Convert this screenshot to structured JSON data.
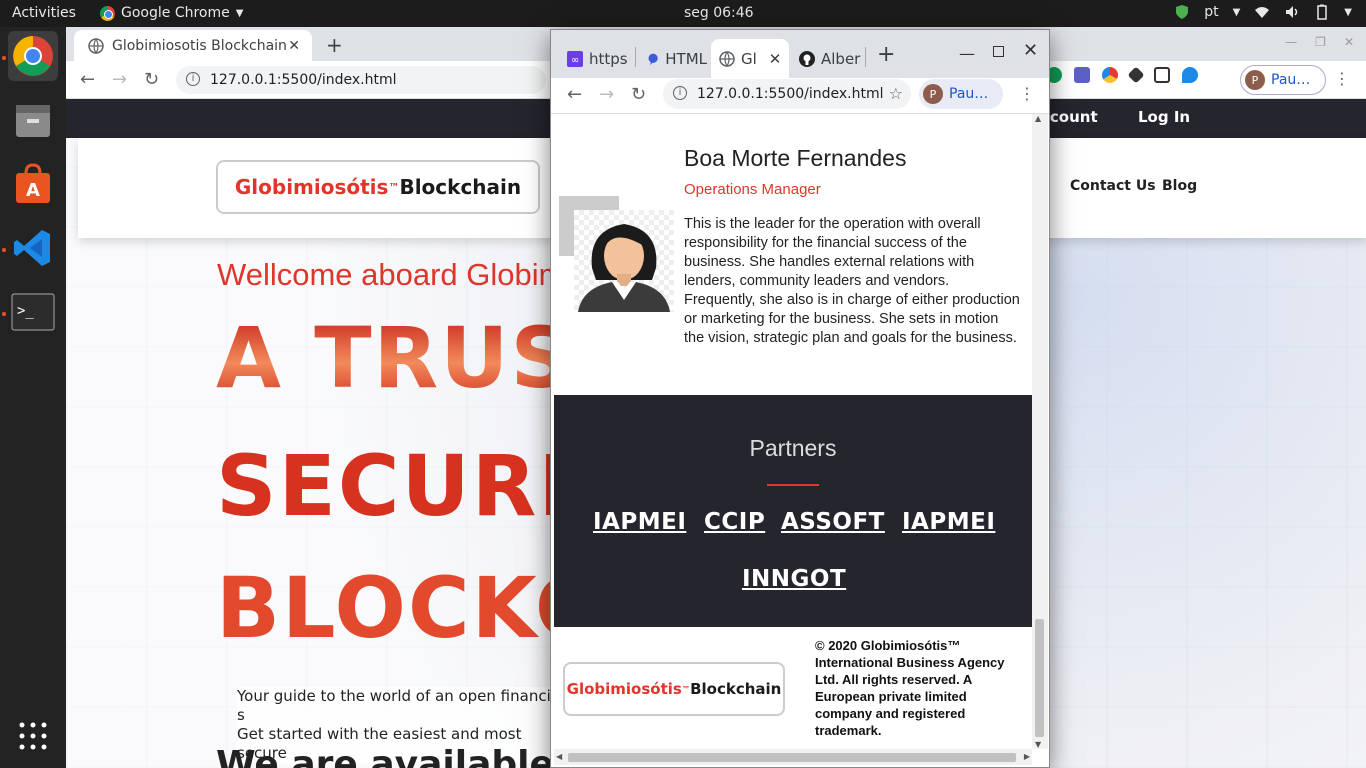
{
  "topbar": {
    "activities": "Activities",
    "app_name": "Google Chrome",
    "clock": "seg 06:46",
    "lang": "pt"
  },
  "dock": {
    "items": [
      "chrome-icon",
      "files-icon",
      "software-store-icon",
      "vscode-icon",
      "terminal-icon"
    ],
    "apps_grid": "show-applications-icon"
  },
  "bg_browser": {
    "tab_title": "Globimiosotis Blockchain",
    "url": "127.0.0.1:5500/index.html",
    "profile": "Pau…",
    "nav_account": "ccount",
    "nav_login": "Log In",
    "logo_red": "Globimiosótis",
    "logo_tm": "™",
    "logo_black": "Blockchain",
    "nav_contact": "Contact Us",
    "nav_blog": "Blog",
    "wellcome": "Wellcome aboard Globim",
    "hero_line1": "A TRUST",
    "hero_line2": "SECURE",
    "hero_line3": "BLOCKC",
    "guide_line1": "Your guide to the world of an open financial s",
    "guide_line2": "Get started with the easiest and most secure",
    "available": "We are available a"
  },
  "fg_browser": {
    "tabs": [
      {
        "label": "https",
        "icon": "purple-x-icon"
      },
      {
        "label": "HTML",
        "icon": "blue-chat-icon"
      },
      {
        "label": "Gl",
        "icon": "globe-icon"
      },
      {
        "label": "Alber",
        "icon": "github-icon"
      }
    ],
    "url": "127.0.0.1:5500/index.html",
    "profile": "Pau…",
    "person": {
      "name": "Boa Morte Fernandes",
      "role": "Operations Manager",
      "bio": "This is the leader for the operation with overall responsibility for the financial success of the business. She handles external relations with lenders, community leaders and vendors. Frequently, she also is in charge of either production or marketing for the business. She sets in motion the vision, strategic plan and goals for the business."
    },
    "partners": {
      "title": "Partners",
      "list": [
        "IAPMEI",
        "CCIP",
        "ASSOFT",
        "IAPMEI",
        "INNGOT"
      ]
    },
    "footer": {
      "logo_red": "Globimiosótis",
      "logo_tm": "™",
      "logo_black": "Blockchain",
      "copyright": "© 2020 Globimiosótis™ International Business Agency Ltd. All rights reserved. A European private limited company and registered trademark."
    }
  }
}
